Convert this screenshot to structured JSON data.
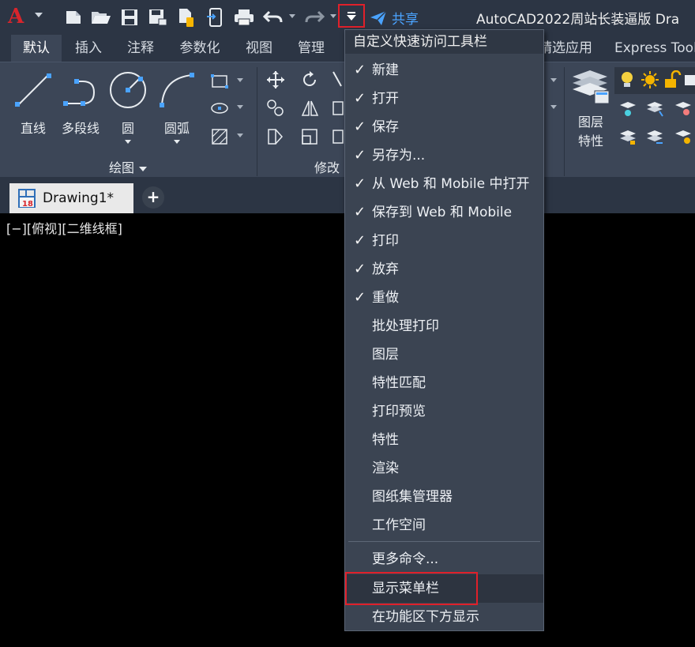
{
  "window": {
    "title": "AutoCAD2022周站长装逼版   Dra",
    "share_label": "共享",
    "accent_red": "#e0202a",
    "share_color": "#4aa3ff"
  },
  "qat": {
    "icons": [
      "app-logo-icon",
      "new-file-icon",
      "open-folder-icon",
      "save-icon",
      "save-as-icon",
      "open-web-mobile-icon",
      "save-web-mobile-icon",
      "print-icon",
      "undo-icon",
      "redo-icon",
      "customize-dropdown-icon",
      "share-icon"
    ]
  },
  "ribbon_tabs": [
    {
      "label": "默认",
      "active": true
    },
    {
      "label": "插入"
    },
    {
      "label": "注释"
    },
    {
      "label": "参数化"
    },
    {
      "label": "视图"
    },
    {
      "label": "管理"
    },
    {
      "label": "精选应用"
    },
    {
      "label": "Express Tools"
    }
  ],
  "ribbon": {
    "draw_tools": [
      {
        "label": "直线",
        "icon": "line-icon"
      },
      {
        "label": "多段线",
        "icon": "polyline-icon"
      },
      {
        "label": "圆",
        "icon": "circle-icon"
      },
      {
        "label": "圆弧",
        "icon": "arc-icon"
      }
    ],
    "draw_panel_title": "绘图",
    "modify_panel_title": "修改",
    "layer_tool_label_1": "图层",
    "layer_tool_label_2": "特性"
  },
  "doc_tabs": {
    "active_tab": "Drawing1*",
    "add_label": "+"
  },
  "viewport": {
    "label": "[−][俯视][二维线框]"
  },
  "menu": {
    "header": "自定义快速访问工具栏",
    "items": [
      {
        "label": "新建",
        "checked": "✓"
      },
      {
        "label": "打开",
        "checked": "✓"
      },
      {
        "label": "保存",
        "checked": "✓"
      },
      {
        "label": "另存为...",
        "checked": "✓"
      },
      {
        "label": "从 Web 和 Mobile 中打开",
        "checked": "✓"
      },
      {
        "label": "保存到 Web 和 Mobile",
        "checked": "✓"
      },
      {
        "label": "打印",
        "checked": "✓"
      },
      {
        "label": "放弃",
        "checked": "✓"
      },
      {
        "label": "重做",
        "checked": "✓"
      },
      {
        "label": "批处理打印"
      },
      {
        "label": "图层"
      },
      {
        "label": "特性匹配"
      },
      {
        "label": "打印预览"
      },
      {
        "label": "特性"
      },
      {
        "label": "渲染"
      },
      {
        "label": "图纸集管理器"
      },
      {
        "label": "工作空间"
      },
      {
        "label": "更多命令..."
      },
      {
        "label": "显示菜单栏"
      },
      {
        "label": "在功能区下方显示"
      }
    ]
  }
}
